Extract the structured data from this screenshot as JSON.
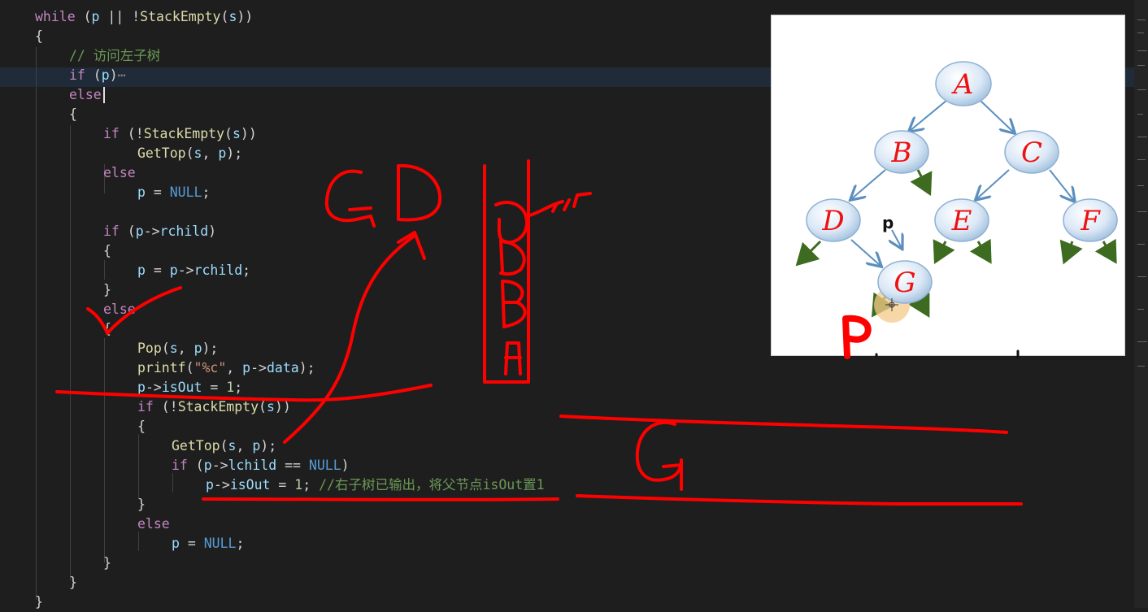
{
  "code": {
    "line1": {
      "kw": "while",
      "pre": " (",
      "v1": "p",
      "mid": " || !",
      "fn": "StackEmpty",
      "open": "(",
      "v2": "s",
      "close": "))"
    },
    "line2": "{",
    "line3": "// 访问左子树",
    "line4": {
      "kw": "if",
      "pre": " (",
      "v": "p",
      "close": ")",
      "fold": "⋯"
    },
    "line5": "else",
    "line6": "{",
    "line7": {
      "kw": "if",
      "pre": " (!",
      "fn": "StackEmpty",
      "open": "(",
      "v": "s",
      "close": "))"
    },
    "line8": {
      "fn": "GetTop",
      "open": "(",
      "v1": "s",
      "sep": ", ",
      "v2": "p",
      "close": ");"
    },
    "line9": "else",
    "line10": {
      "v": "p",
      "eq": " = ",
      "const": "NULL",
      "end": ";"
    },
    "line11": {
      "kw": "if",
      "pre": " (",
      "v1": "p",
      "arrow": "->",
      "v2": "rchild",
      "close": ")"
    },
    "line12": "{",
    "line13": {
      "v1": "p",
      "eq": " = ",
      "v2": "p",
      "arrow": "->",
      "v3": "rchild",
      "end": ";"
    },
    "line14": "}",
    "line15": "else",
    "line16": "{",
    "line17": {
      "fn": "Pop",
      "open": "(",
      "v1": "s",
      "sep": ", ",
      "v2": "p",
      "close": ");"
    },
    "line18": {
      "fn": "printf",
      "open": "(",
      "str": "\"%c\"",
      "sep": ", ",
      "v1": "p",
      "arrow": "->",
      "v2": "data",
      "close": ");"
    },
    "line19": {
      "v1": "p",
      "arrow": "->",
      "v2": "isOut",
      "eq": " = ",
      "num": "1",
      "end": ";"
    },
    "line20": {
      "kw": "if",
      "pre": " (!",
      "fn": "StackEmpty",
      "open": "(",
      "v": "s",
      "close": "))"
    },
    "line21": "{",
    "line22": {
      "fn": "GetTop",
      "open": "(",
      "v1": "s",
      "sep": ", ",
      "v2": "p",
      "close": ");"
    },
    "line23": {
      "kw": "if",
      "pre": " (",
      "v1": "p",
      "arrow": "->",
      "v2": "lchild",
      "eq": " == ",
      "const": "NULL",
      "close": ")"
    },
    "line24": {
      "v1": "p",
      "arrow": "->",
      "v2": "isOut",
      "eq": " = ",
      "num": "1",
      "end": "; ",
      "comment": "//右子树已输出，将父节点isOut置1"
    },
    "line25": "}",
    "line26": "else",
    "line27": {
      "v": "p",
      "eq": " = ",
      "const": "NULL",
      "end": ";"
    },
    "line28": "}",
    "line29": "}",
    "line30": "}"
  },
  "tree": {
    "nodes": [
      "A",
      "B",
      "C",
      "D",
      "E",
      "F",
      "G"
    ],
    "pointer_label": "p"
  },
  "handwriting": [
    "GD",
    "G",
    "D",
    "B",
    "A",
    "G",
    "P"
  ],
  "colors": {
    "ink": "#ff0000",
    "node_fill": "#dce8f5",
    "node_letter": "#e11",
    "edge": "#5b8fbf",
    "null_arrow": "#3d6b1f"
  }
}
